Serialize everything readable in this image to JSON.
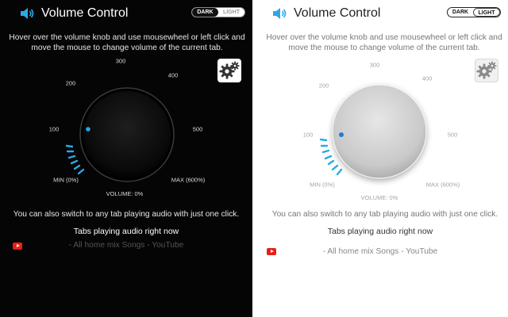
{
  "panels": [
    {
      "theme": "dark",
      "app_title": "Volume Control",
      "theme_toggle": {
        "dark_label": "DARK",
        "light_label": "LIGHT",
        "selected": "DARK"
      },
      "instructions": "Hover over the volume knob and use mousewheel or left click and move the mouse to change volume of the current tab.",
      "knob": {
        "tick_labels": {
          "min": "MIN (0%)",
          "t100": "100",
          "t200": "200",
          "t300": "300",
          "t400": "400",
          "t500": "500",
          "max": "MAX (600%)"
        },
        "volume_label": "VOLUME: 0%",
        "volume_percent": 0,
        "knob_color": "#111111",
        "indicator_color": "#29a9e8",
        "tick_color": "#29a9e8"
      },
      "switch_note": "You can also switch to any tab playing audio with just one click.",
      "tabs_heading": "Tabs playing audio right now",
      "tabs": [
        {
          "icon": "youtube-icon",
          "title": "- All home mix Songs - YouTube"
        }
      ]
    },
    {
      "theme": "light",
      "app_title": "Volume Control",
      "theme_toggle": {
        "dark_label": "DARK",
        "light_label": "LIGHT",
        "selected": "LIGHT"
      },
      "instructions": "Hover over the volume knob and use mousewheel or left click and move the mouse to change volume of the current tab.",
      "knob": {
        "tick_labels": {
          "min": "MIN (0%)",
          "t100": "100",
          "t200": "200",
          "t300": "300",
          "t400": "400",
          "t500": "500",
          "max": "MAX (600%)"
        },
        "volume_label": "VOLUME: 0%",
        "volume_percent": 0,
        "knob_color": "#d4d4d4",
        "indicator_color": "#1a7fd6",
        "tick_color": "#29a9e8"
      },
      "switch_note": "You can also switch to any tab playing audio with just one click.",
      "tabs_heading": "Tabs playing audio right now",
      "tabs": [
        {
          "icon": "youtube-icon",
          "title": "- All home mix Songs - YouTube"
        }
      ]
    }
  ]
}
